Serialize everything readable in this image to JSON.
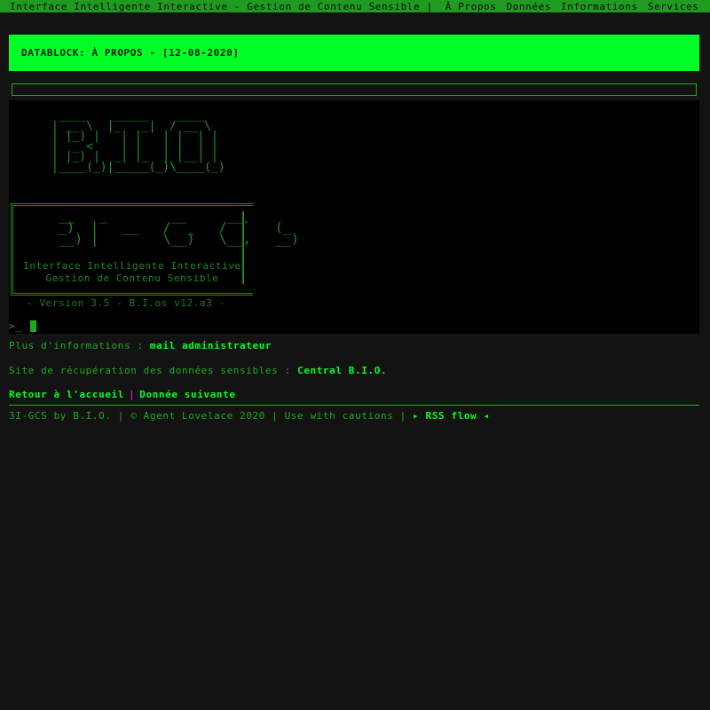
{
  "topnav": {
    "site_title": "Interface Intelligente Interactive - Gestion de Contenu Sensible |",
    "links": [
      "À Propos",
      "Données",
      "Informations",
      "Services"
    ]
  },
  "banner": {
    "title": "DATABLOCK: À PROPOS - [12-08-2020]"
  },
  "terminal": {
    "ascii_bio": " ____    _____    ____\n| __ \\  |_   _|  / __ \\\n| |_) |   | |   | |  | |\n|  _ <    | |   | |  | |\n| |_) |  _| |_  | |__| |\n|____(_)|_____(_)\\____(_)",
    "ascii_3igcs": "  __   _        __     __\n  _)  |   __   /  _   /  `   (_ \n  __) |        \\__)   \\__,   __)",
    "subtitle_line1": "Interface Intelligente Interactive",
    "subtitle_line2": "Gestion de Contenu Sensible",
    "version": "- Version 3.5 - B.I.os v12.a3 -",
    "prompt": ">_"
  },
  "info": {
    "more_info_label": "Plus d'informations :",
    "more_info_link": "mail administrateur",
    "recovery_label": "Site de récupération des données sensibles :",
    "recovery_link": "Central B.I.O.",
    "back_link": "Retour à l'accueil",
    "separator": "|",
    "next_link": "Donnée suivante"
  },
  "footer": {
    "text": "3I-GCS by B.I.O. | © Agent Lovelace 2020 | Use with cautions |",
    "rss_link": "▸ RSS flow ◂"
  },
  "colors": {
    "accent": "#00ff26",
    "nav_bg": "#1f9b1f",
    "text": "#1faa1f",
    "separator": "#ff2bdc",
    "background": "#131313"
  }
}
